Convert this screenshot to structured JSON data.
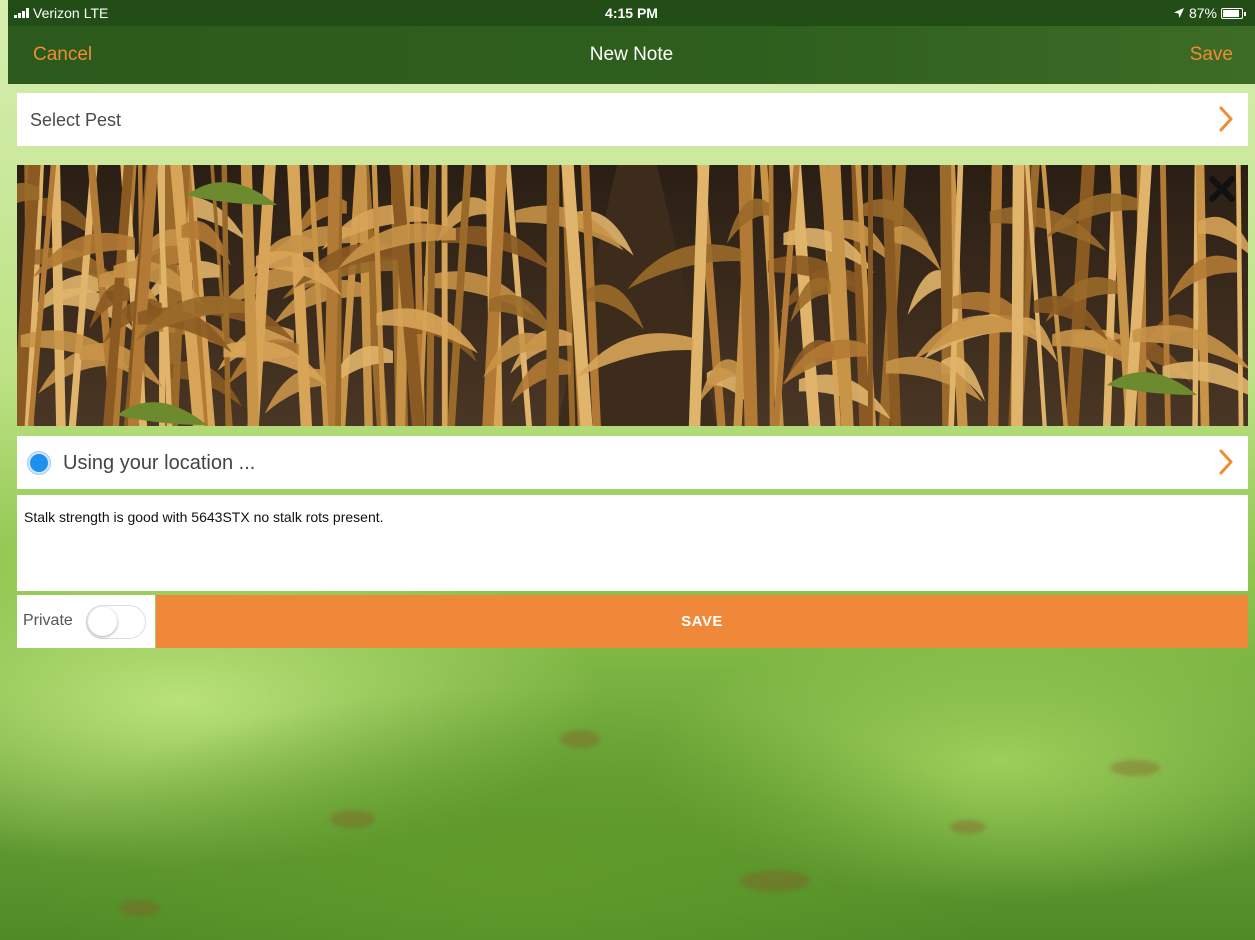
{
  "status_bar": {
    "carrier": "Verizon",
    "network": "LTE",
    "time": "4:15 PM",
    "battery": "87%",
    "battery_level": 0.87,
    "icons": [
      "signal-bars-icon",
      "location-arrow-icon",
      "battery-icon"
    ]
  },
  "nav": {
    "cancel_label": "Cancel",
    "title": "New Note",
    "save_label": "Save"
  },
  "pest_row": {
    "label": "Select Pest",
    "icon": "chevron-right-icon"
  },
  "photo": {
    "subject": "corn-field-photo",
    "remove_icon": "close-x-icon"
  },
  "location_row": {
    "label": "Using your location ...",
    "icon": "chevron-right-icon"
  },
  "note": {
    "text": "Stalk strength is good with 5643STX no stalk rots present."
  },
  "footer": {
    "private_label": "Private",
    "private_on": false,
    "save_button_label": "SAVE"
  },
  "colors": {
    "accent": "#f0883a",
    "nav_bg": "#2c5a1c",
    "radio_blue": "#1e90f0"
  }
}
